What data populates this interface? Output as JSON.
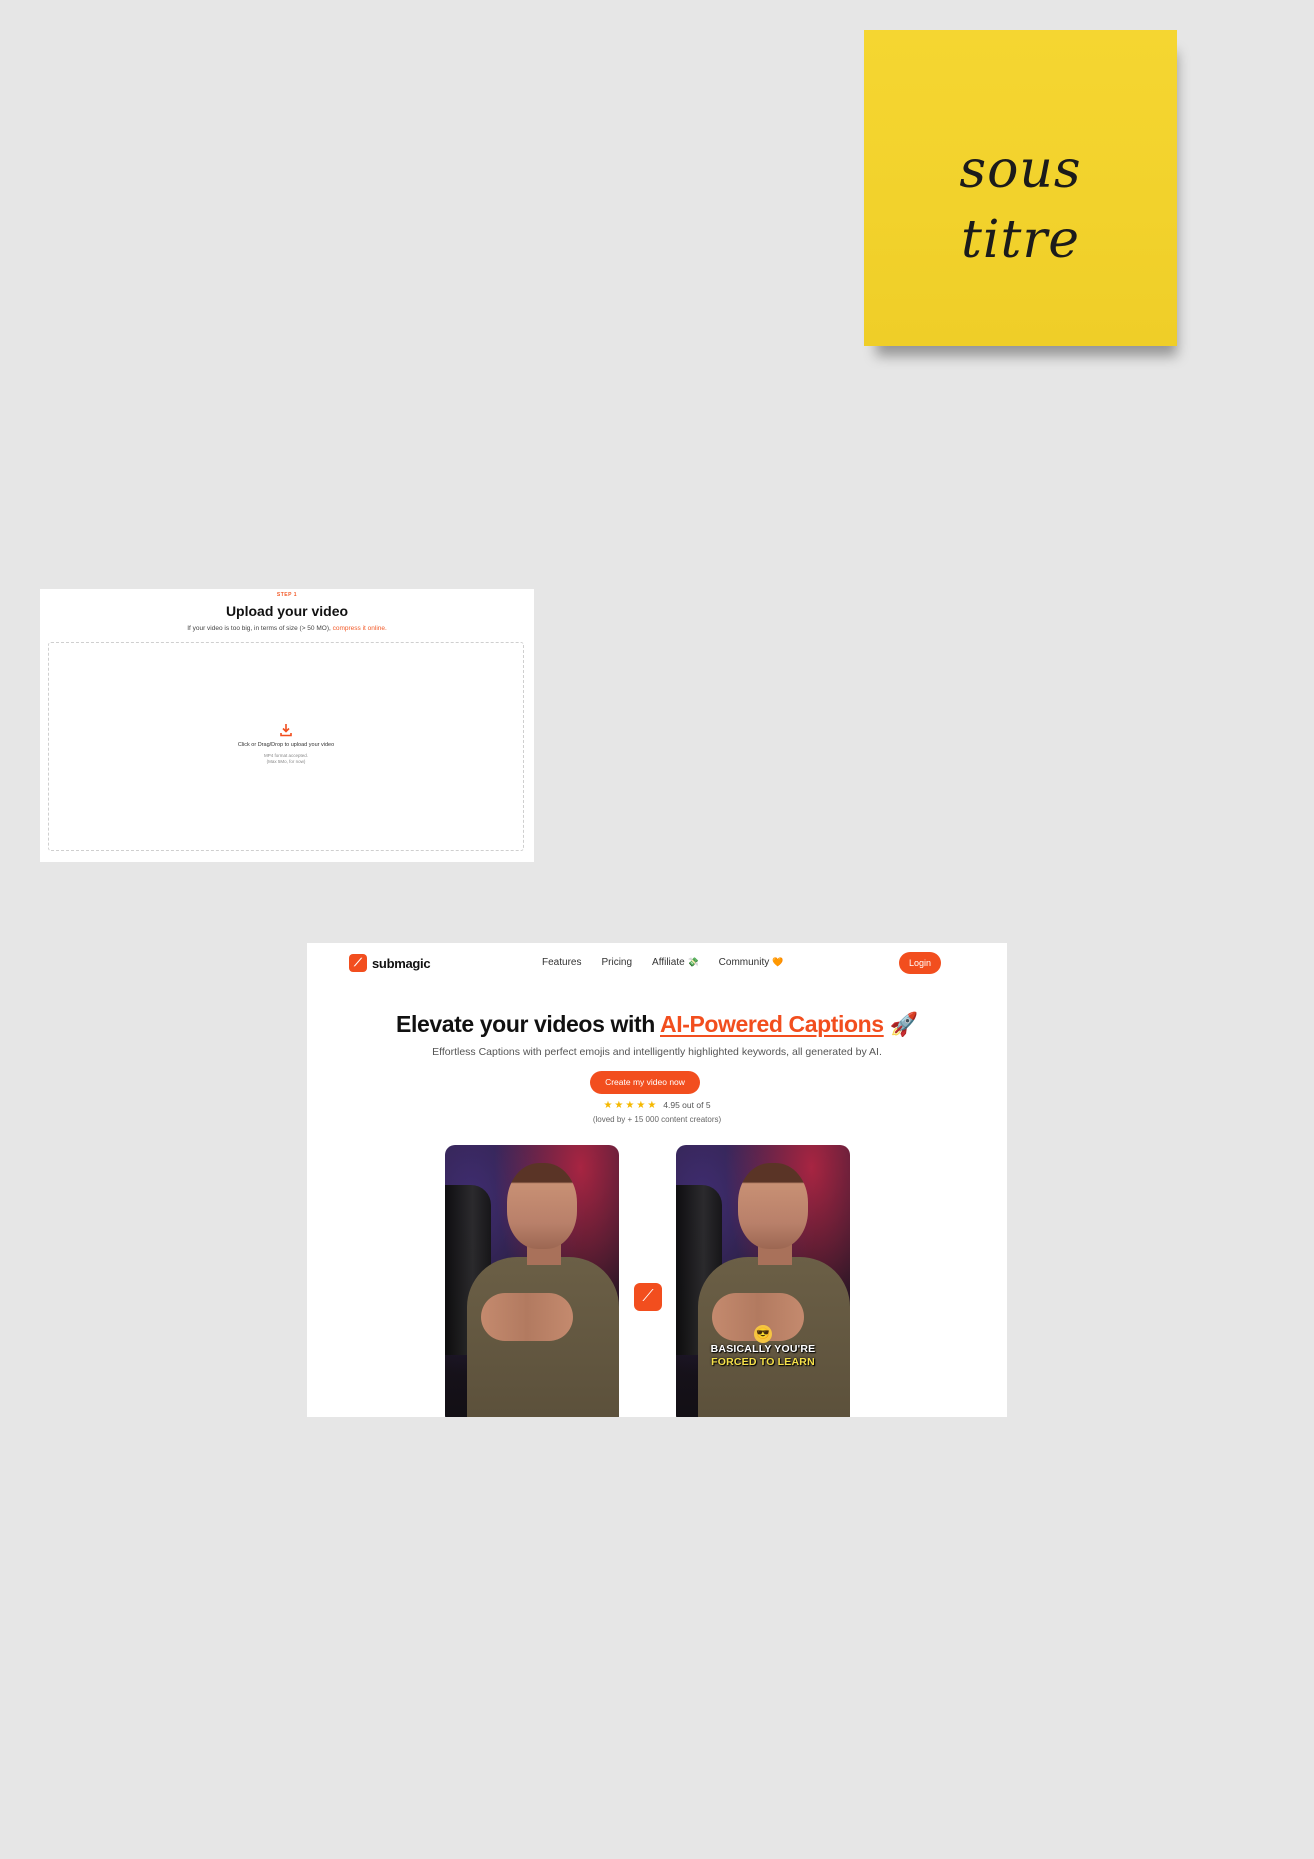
{
  "sticky_note": {
    "line_1": "sous",
    "line_2": "titre"
  },
  "upload": {
    "step_label": "STEP 1",
    "title": "Upload your video",
    "hint": "If your video is too big, in terms of size (> 50 MO),",
    "hint_link": "compress it online.",
    "drop_icon": "download-icon",
    "drop_main": "Click or Drag/Drop to upload your video",
    "drop_sub_1": "MP4 format accepted.",
    "drop_sub_2": "(Max 5Mo, for now)"
  },
  "website": {
    "brand": "submagic",
    "nav": {
      "features": "Features",
      "pricing": "Pricing",
      "affiliate": "Affiliate",
      "affiliate_emoji": "💸",
      "community": "Community",
      "community_emoji": "🧡"
    },
    "login_label": "Login",
    "hero": {
      "title_prefix": "Elevate your videos with ",
      "title_accent": "AI-Powered Captions",
      "title_emoji": "🚀",
      "subtitle": "Effortless Captions with perfect emojis and intelligently highlighted keywords, all generated by AI."
    },
    "cta_label": "Create my video now",
    "rating": {
      "stars": "★★★★★",
      "text": "4.95 out of 5",
      "loved_by": "(loved by + 15 000 content creators)"
    },
    "caption": {
      "emoji": "😎",
      "line_1": "BASICALLY YOU'RE",
      "line_2": "FORCED TO LEARN"
    },
    "colors": {
      "accent": "#f24e1e",
      "star": "#f5b800",
      "sticky": "#f2d22c",
      "canvas": "#e6e6e6"
    }
  }
}
